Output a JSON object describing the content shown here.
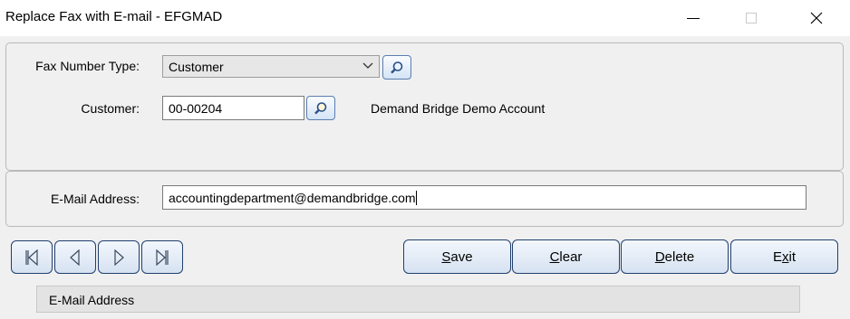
{
  "window": {
    "title": "Replace Fax with E-mail - EFGMAD",
    "minimize_icon": "minimize-icon",
    "maximize_icon": "maximize-icon",
    "close_icon": "close-icon"
  },
  "form": {
    "fax_type_label": "Fax Number Type:",
    "fax_type_value": "Customer",
    "customer_label": "Customer:",
    "customer_value": "00-00204",
    "customer_name": "Demand Bridge Demo Account",
    "email_label": "E-Mail Address:",
    "email_value": "accountingdepartment@demandbridge.com"
  },
  "nav": {
    "icons": [
      "first-record-icon",
      "previous-record-icon",
      "next-record-icon",
      "last-record-icon"
    ]
  },
  "buttons": {
    "save": {
      "first": "S",
      "rest": "ave"
    },
    "clear": {
      "first": "C",
      "rest": "lear"
    },
    "delete": {
      "first": "D",
      "rest": "elete"
    },
    "exit_prefix": "E",
    "exit_underlined": "x",
    "exit_suffix": "it"
  },
  "status": {
    "text": "E-Mail Address"
  },
  "colors": {
    "button_border": "#1f3f6e",
    "button_fill_top": "#f3f7fd",
    "button_fill_bottom": "#d6e2f1",
    "panel_bg": "#f0f0f0"
  }
}
